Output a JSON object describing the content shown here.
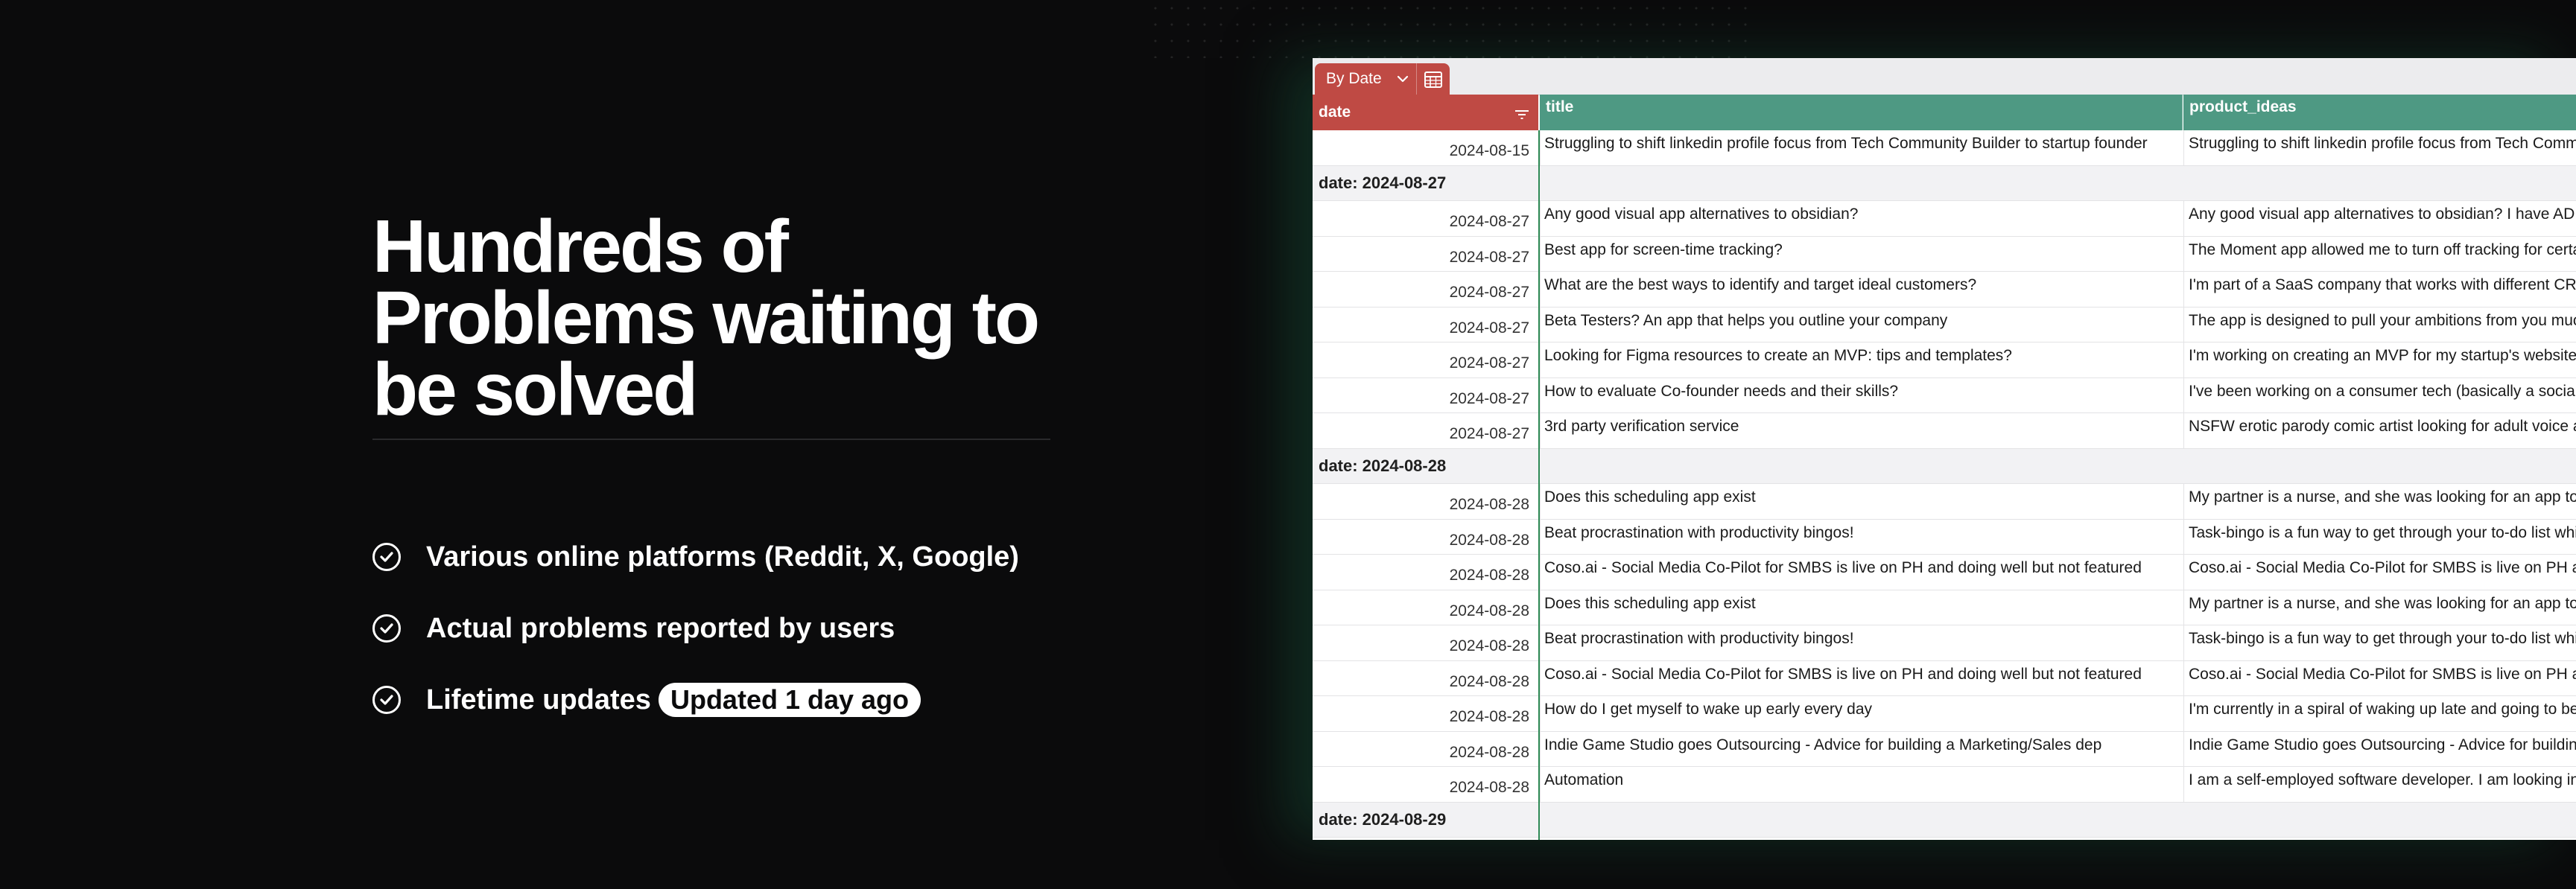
{
  "hero": {
    "title_line1": "Hundreds of",
    "title_line2": "Problems waiting to",
    "title_line3": "be solved"
  },
  "features": [
    {
      "label": "Various online platforms (Reddit, X, Google)"
    },
    {
      "label": "Actual problems reported by users"
    },
    {
      "label": "Lifetime updates",
      "badge": "Updated 1 day ago"
    }
  ],
  "sheet": {
    "view_label": "By Date",
    "columns": {
      "date": "date",
      "title": "title",
      "product_ideas": "product_ideas"
    },
    "rows": [
      {
        "kind": "data",
        "date": "2024-08-15",
        "title": "Struggling to shift linkedin profile focus from Tech Community Builder to startup founder",
        "idea": "Struggling to shift linkedin profile focus from Tech Community Builder to startup founder"
      },
      {
        "kind": "group",
        "label": "date: 2024-08-27"
      },
      {
        "kind": "data",
        "date": "2024-08-27",
        "title": "Any good visual app alternatives to obsidian?",
        "idea": "Any good visual app alternatives to obsidian? I have ADHD"
      },
      {
        "kind": "data",
        "date": "2024-08-27",
        "title": "Best app for screen-time tracking?",
        "idea": "The Moment app allowed me to turn off tracking for certain apps"
      },
      {
        "kind": "data",
        "date": "2024-08-27",
        "title": "What are the best ways to identify and target ideal customers?",
        "idea": "I'm part of a SaaS company that works with different CRMs"
      },
      {
        "kind": "data",
        "date": "2024-08-27",
        "title": "Beta Testers? An app that helps you outline your company",
        "idea": "The app is designed to pull your ambitions from you much"
      },
      {
        "kind": "data",
        "date": "2024-08-27",
        "title": "Looking for Figma resources to create an MVP: tips and templates?",
        "idea": "I'm working on creating an MVP for my startup's website"
      },
      {
        "kind": "data",
        "date": "2024-08-27",
        "title": "How to evaluate Co-founder needs and their skills?",
        "idea": "I've been working on a consumer tech (basically a social app)"
      },
      {
        "kind": "data",
        "date": "2024-08-27",
        "title": "3rd party verification service",
        "idea": "NSFW erotic parody comic artist looking for adult voice actors"
      },
      {
        "kind": "group",
        "label": "date: 2024-08-28"
      },
      {
        "kind": "data",
        "date": "2024-08-28",
        "title": "Does this scheduling app exist",
        "idea": "My partner is a nurse, and she was looking for an app to schedule"
      },
      {
        "kind": "data",
        "date": "2024-08-28",
        "title": "Beat procrastination with productivity bingos!",
        "idea": "Task-bingo is a fun way to get through your to-do list while"
      },
      {
        "kind": "data",
        "date": "2024-08-28",
        "title": "Coso.ai - Social Media Co-Pilot for SMBS is live on PH and doing well but not featured",
        "idea": "Coso.ai - Social Media Co-Pilot for SMBS is live on PH and doing"
      },
      {
        "kind": "data",
        "date": "2024-08-28",
        "title": "Does this scheduling app exist",
        "idea": "My partner is a nurse, and she was looking for an app to schedule"
      },
      {
        "kind": "data",
        "date": "2024-08-28",
        "title": "Beat procrastination with productivity bingos!",
        "idea": "Task-bingo is a fun way to get through your to-do list while"
      },
      {
        "kind": "data",
        "date": "2024-08-28",
        "title": "Coso.ai - Social Media Co-Pilot for SMBS is live on PH and doing well but not featured",
        "idea": "Coso.ai - Social Media Co-Pilot for SMBS is live on PH and doing"
      },
      {
        "kind": "data",
        "date": "2024-08-28",
        "title": "How do I get myself to wake up early every day",
        "idea": "I'm currently in a spiral of waking up late and going to bed late"
      },
      {
        "kind": "data",
        "date": "2024-08-28",
        "title": "Indie Game Studio goes Outsourcing - Advice for building a Marketing/Sales dep",
        "idea": "Indie Game Studio goes Outsourcing - Advice for building a"
      },
      {
        "kind": "data",
        "date": "2024-08-28",
        "title": "Automation",
        "idea": "I am a self-employed software developer. I am looking into"
      },
      {
        "kind": "group",
        "label": "date: 2024-08-29"
      }
    ]
  },
  "colors": {
    "background": "#0b0b0c",
    "date_header": "#bf4a44",
    "column_header": "#4e9983",
    "selection": "#2e8a55"
  },
  "icons": [
    "check-circle-icon",
    "chevron-down-icon",
    "grid-view-icon",
    "filter-icon"
  ]
}
